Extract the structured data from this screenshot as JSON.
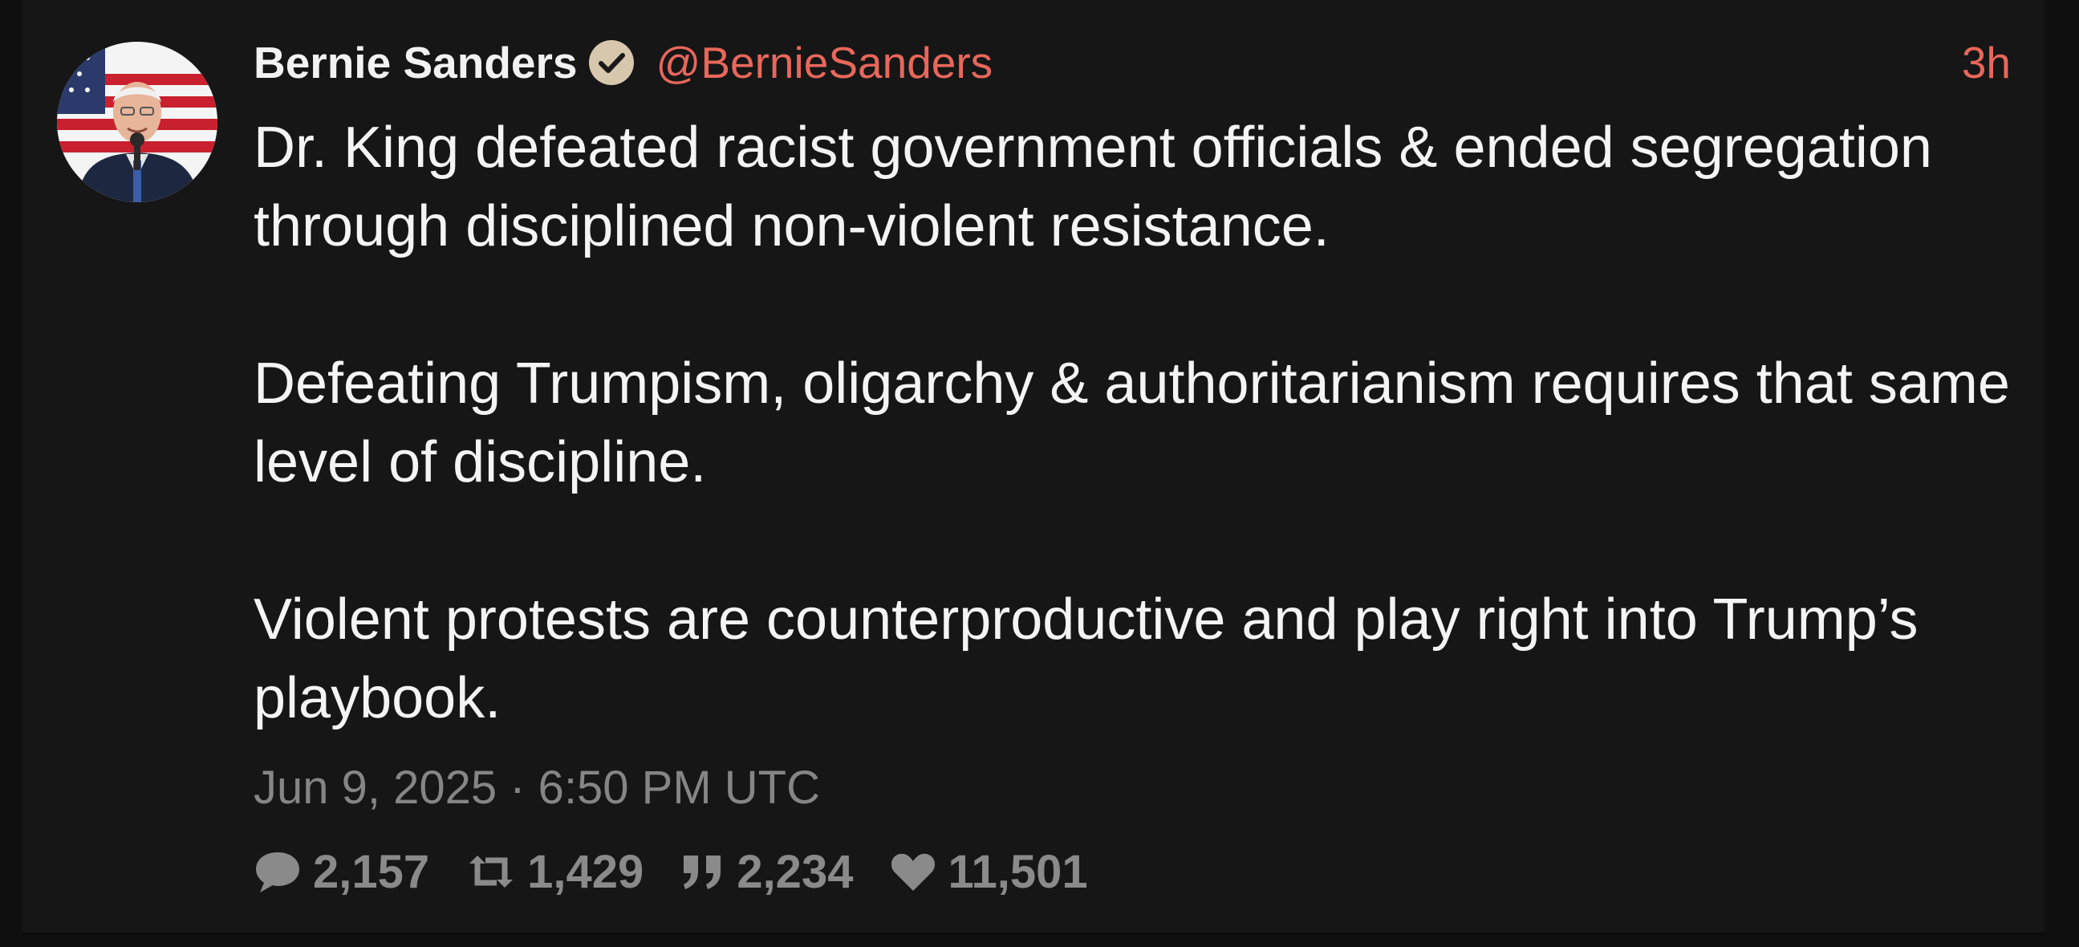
{
  "tweet": {
    "author": {
      "full_name": "Bernie Sanders",
      "username": "@BernieSanders",
      "avatar_icon": "avatar-photo",
      "verified_icon": "verified-badge-icon"
    },
    "relative_time": "3h",
    "paragraphs": [
      "Dr. King defeated racist government officials & ended segregation through disciplined non-violent resistance.",
      "Defeating Trumpism, oligarchy & authoritarianism requires that same level of discipline.",
      "Violent protests are counterproductive and play right into Trump’s playbook."
    ],
    "date": "Jun 9, 2025 · 6:50 PM UTC",
    "stats": {
      "replies": "2,157",
      "retweets": "1,429",
      "quotes": "2,234",
      "likes": "11,501"
    }
  },
  "colors": {
    "background": "#161616",
    "accent": "#e8675b",
    "text": "#f4f4f4",
    "muted": "#858585"
  }
}
